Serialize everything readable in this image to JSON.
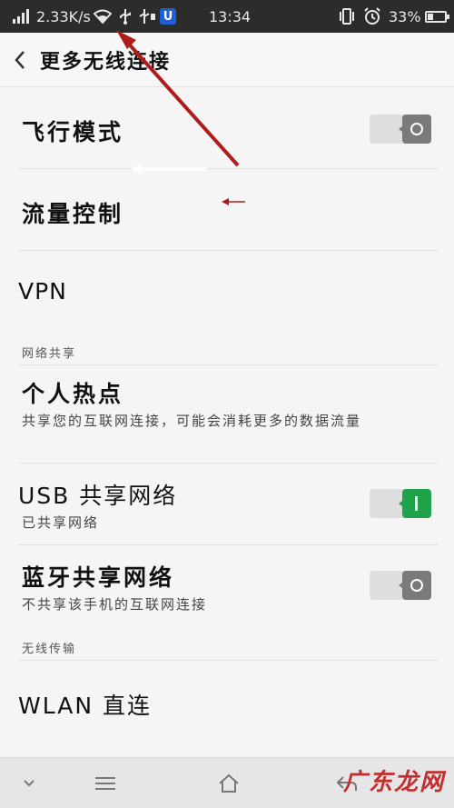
{
  "status_bar": {
    "net_speed": "2.33K/s",
    "time": "13:34",
    "battery": "33%",
    "battery_level": 0.33,
    "icons": [
      "signal-icon",
      "wifi-icon",
      "usb-icon",
      "usb-debug-icon",
      "app-u-icon",
      "vibrate-icon",
      "alarm-icon",
      "battery-icon"
    ]
  },
  "header": {
    "title": "更多无线连接"
  },
  "items": {
    "airplane": {
      "label": "飞行模式",
      "enabled": false
    },
    "traffic": {
      "label": "流量控制"
    },
    "vpn": {
      "label": "VPN"
    },
    "hotspot": {
      "label": "个人热点",
      "subtitle": "共享您的互联网连接，可能会消耗更多的数据流量"
    },
    "usb_tether": {
      "label": "USB 共享网络",
      "subtitle": "已共享网络",
      "enabled": true
    },
    "bt_tether": {
      "label": "蓝牙共享网络",
      "subtitle": "不共享该手机的互联网连接",
      "enabled": false
    },
    "wlan_direct": {
      "label": "WLAN 直连"
    }
  },
  "sections": {
    "tethering": "网络共享",
    "wireless_transfer": "无线传输"
  },
  "navbar": {
    "icons": [
      "chevron-down-icon",
      "menu-icon",
      "home-icon",
      "back-icon"
    ]
  },
  "watermark": "广东龙网",
  "colors": {
    "status_bar_bg": "#2c2c2c",
    "toggle_on": "#1fa34a",
    "toggle_off": "#7a7a7a",
    "annotation_arrow": "#b01c1c"
  }
}
